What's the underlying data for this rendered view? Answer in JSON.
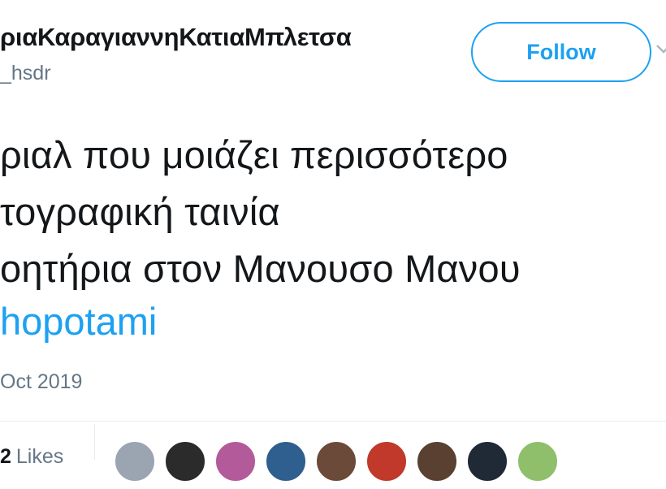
{
  "tweet": {
    "display_name": "ριαΚαραγιαννηΚατιαΜπλετσα",
    "handle": "_hsdr",
    "follow_label": "Follow",
    "lines": [
      "ριαλ που μοιάζει περισσότερο",
      "τογραφική ταινία",
      "οητήρια στον Μανουσο Μανου"
    ],
    "hashtag": "hopotami",
    "timestamp": "Oct 2019",
    "likes_count": "2",
    "likes_label": "Likes"
  },
  "avatars": [
    {
      "name": "liker-avatar-1",
      "color": "#9aa5b1"
    },
    {
      "name": "liker-avatar-2",
      "color": "#2b2b2b"
    },
    {
      "name": "liker-avatar-3",
      "color": "#b35a9a"
    },
    {
      "name": "liker-avatar-4",
      "color": "#2f5f8f"
    },
    {
      "name": "liker-avatar-5",
      "color": "#6b4a3a"
    },
    {
      "name": "liker-avatar-6",
      "color": "#c0392b"
    },
    {
      "name": "liker-avatar-7",
      "color": "#5a4030"
    },
    {
      "name": "liker-avatar-8",
      "color": "#1f2a36"
    },
    {
      "name": "liker-avatar-9",
      "color": "#8fbf6a"
    }
  ],
  "colors": {
    "accent": "#1da1f2",
    "secondary_text": "#657786",
    "primary_text": "#14171a"
  }
}
